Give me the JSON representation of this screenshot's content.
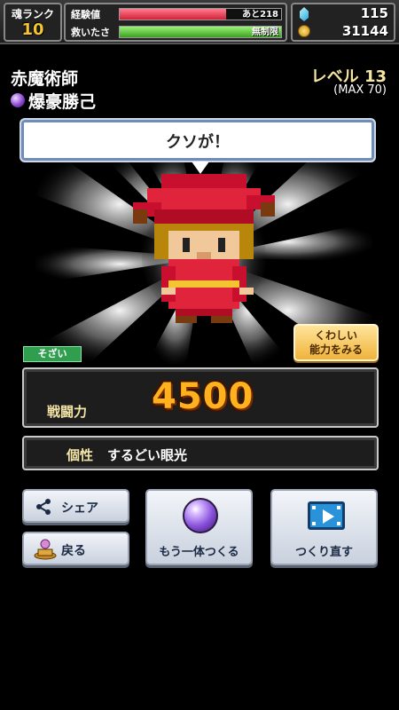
{
  "header": {
    "rank_label": "魂ランク",
    "rank_value": "10",
    "exp_label": "経験値",
    "exp_text": "あと218",
    "exp_fill": 0.66,
    "save_label": "救いたさ",
    "save_text": "無制限",
    "save_fill": 1.0,
    "gems": "115",
    "coins": "31144"
  },
  "character": {
    "class_name": "赤魔術師",
    "name": "爆豪勝己",
    "level_text": "レベル 13",
    "level_max": "(MAX 70)",
    "speech": "クソが！"
  },
  "stage": {
    "detail_button": [
      "くわしい",
      "能力をみる"
    ],
    "tag": "そざい"
  },
  "power": {
    "label": "戦闘力",
    "value": "4500"
  },
  "trait": {
    "label": "個性",
    "value": "するどい眼光"
  },
  "buttons": {
    "share": "シェア",
    "back": "戻る",
    "create_another": "もう一体つくる",
    "remake": "つくり直す"
  },
  "colors": {
    "accent_gold": "#ffb21e",
    "exp_bar": "#d2203a",
    "save_bar": "#3ca11f",
    "tag_green": "#2f9e4f"
  }
}
